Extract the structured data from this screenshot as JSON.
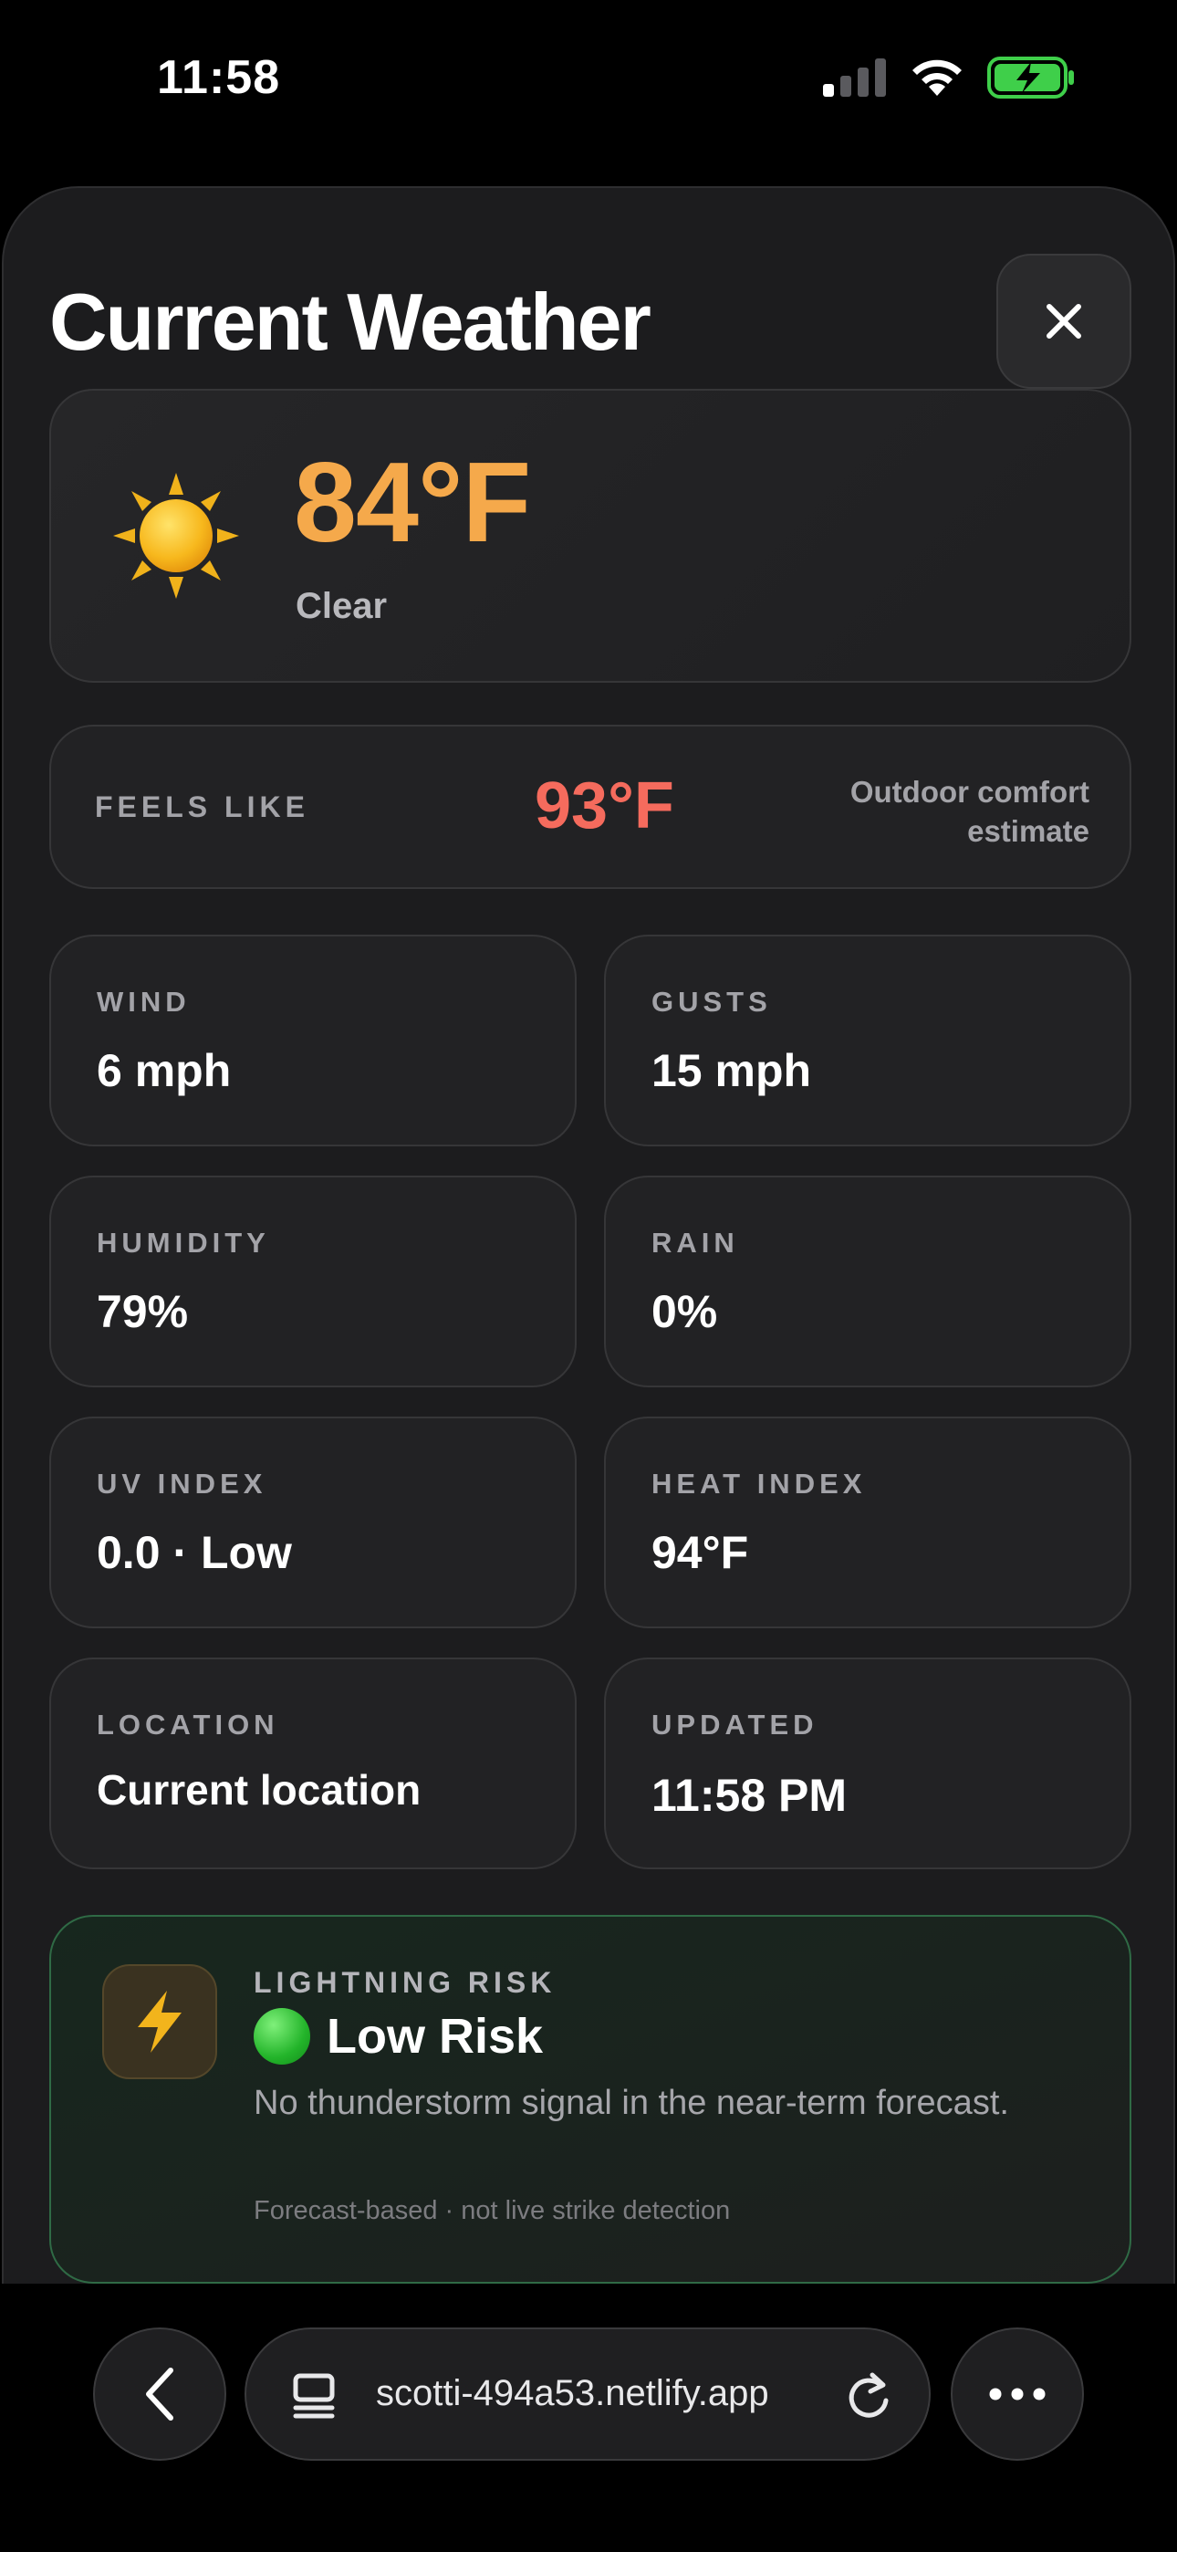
{
  "status_bar": {
    "time": "11:58"
  },
  "sheet": {
    "title": "Current Weather"
  },
  "current": {
    "temperature": "84°F",
    "condition": "Clear",
    "icon": "sun-icon",
    "temp_color": "#f5a94b"
  },
  "feels_like": {
    "label": "FEELS LIKE",
    "value": "93°F",
    "note": "Outdoor comfort estimate",
    "value_color": "#f56b5d"
  },
  "stats": [
    {
      "label": "WIND",
      "value": "6 mph"
    },
    {
      "label": "GUSTS",
      "value": "15 mph"
    },
    {
      "label": "HUMIDITY",
      "value": "79%"
    },
    {
      "label": "RAIN",
      "value": "0%"
    },
    {
      "label": "UV INDEX",
      "value": "0.0 · Low"
    },
    {
      "label": "HEAT INDEX",
      "value": "94°F"
    },
    {
      "label": "LOCATION",
      "value": "Current location"
    },
    {
      "label": "UPDATED",
      "value": "11:58 PM"
    }
  ],
  "lightning": {
    "label": "LIGHTNING RISK",
    "level": "Low Risk",
    "description": "No thunderstorm signal in the near-term forecast.",
    "footnote": "Forecast-based · not live strike detection",
    "accent": "#2f6a45"
  },
  "browser": {
    "url": "scotti-494a53.netlify.app"
  }
}
